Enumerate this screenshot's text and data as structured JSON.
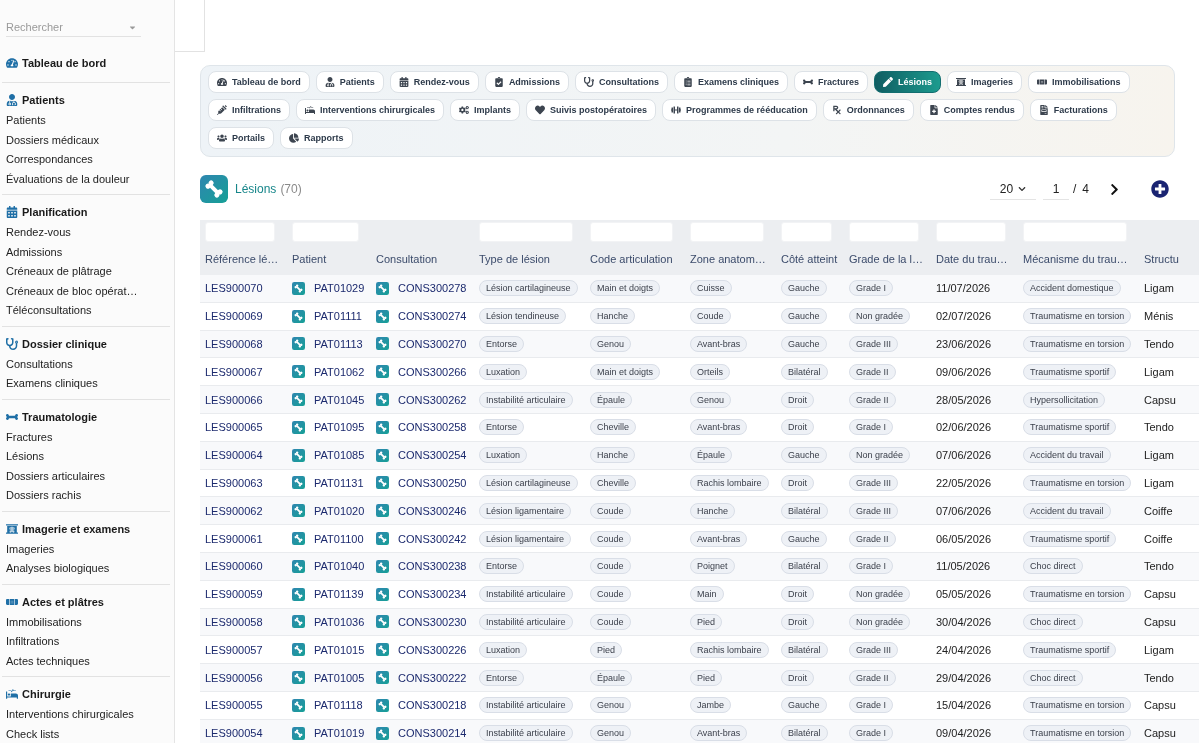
{
  "sidebar": {
    "search": {
      "placeholder": "Rechercher"
    },
    "sections": [
      {
        "title": "Tableau de bord"
      },
      {
        "title": "Patients",
        "items": [
          "Patients",
          "Dossiers médicaux",
          "Correspondances",
          "Évaluations de la douleur"
        ]
      },
      {
        "title": "Planification",
        "items": [
          "Rendez-vous",
          "Admissions",
          "Créneaux de plâtrage",
          "Créneaux de bloc opérat…",
          "Téléconsultations"
        ]
      },
      {
        "title": "Dossier clinique",
        "items": [
          "Consultations",
          "Examens cliniques"
        ]
      },
      {
        "title": "Traumatologie",
        "items": [
          "Fractures",
          "Lésions",
          "Dossiers articulaires",
          "Dossiers rachis"
        ]
      },
      {
        "title": "Imagerie et examens",
        "items": [
          "Imageries",
          "Analyses biologiques"
        ]
      },
      {
        "title": "Actes et plâtres",
        "items": [
          "Immobilisations",
          "Infiltrations",
          "Actes techniques"
        ]
      },
      {
        "title": "Chirurgie",
        "items": [
          "Interventions chirurgicales",
          "Check lists"
        ]
      }
    ]
  },
  "tabs": [
    {
      "label": "Tableau de bord",
      "selected": false
    },
    {
      "label": "Patients",
      "selected": false
    },
    {
      "label": "Rendez-vous",
      "selected": false
    },
    {
      "label": "Admissions",
      "selected": false
    },
    {
      "label": "Consultations",
      "selected": false
    },
    {
      "label": "Examens cliniques",
      "selected": false
    },
    {
      "label": "Fractures",
      "selected": false
    },
    {
      "label": "Lésions",
      "selected": true
    },
    {
      "label": "Imageries",
      "selected": false
    },
    {
      "label": "Immobilisations",
      "selected": false
    },
    {
      "label": "Infiltrations",
      "selected": false
    },
    {
      "label": "Interventions chirurgicales",
      "selected": false
    },
    {
      "label": "Implants",
      "selected": false
    },
    {
      "label": "Suivis postopératoires",
      "selected": false
    },
    {
      "label": "Programmes de rééducation",
      "selected": false
    },
    {
      "label": "Ordonnances",
      "selected": false
    },
    {
      "label": "Comptes rendus",
      "selected": false
    },
    {
      "label": "Facturations",
      "selected": false
    },
    {
      "label": "Portails",
      "selected": false
    },
    {
      "label": "Rapports",
      "selected": false
    }
  ],
  "header": {
    "title": "Lésions",
    "count": "(70)"
  },
  "pagination": {
    "page_size": "20",
    "page": "1",
    "separator": "/",
    "page_count": "4"
  },
  "table": {
    "columns": [
      {
        "label": "Référence lé…",
        "kind": "link",
        "filter": true
      },
      {
        "label": "Patient",
        "kind": "record",
        "filter": true
      },
      {
        "label": "Consultation",
        "kind": "record",
        "filter": false
      },
      {
        "label": "Type de lésion",
        "kind": "tag",
        "filter": true
      },
      {
        "label": "Code articulation",
        "kind": "tag",
        "filter": true
      },
      {
        "label": "Zone anatom…",
        "kind": "tag",
        "filter": true
      },
      {
        "label": "Côté atteint",
        "kind": "tag",
        "filter": true
      },
      {
        "label": "Grade de la l…",
        "kind": "tag",
        "filter": true
      },
      {
        "label": "Date du trau…",
        "kind": "text",
        "filter": true
      },
      {
        "label": "Mécanisme du trau…",
        "kind": "tag",
        "filter": true
      },
      {
        "label": "Structu",
        "kind": "text",
        "filter": false
      }
    ],
    "rows": [
      [
        "LES900070",
        "PAT01029",
        "CONS300278",
        "Lésion cartilagineuse",
        "Main et doigts",
        "Cuisse",
        "Gauche",
        "Grade I",
        "11/07/2026",
        "Accident domestique",
        "Ligam"
      ],
      [
        "LES900069",
        "PAT01111",
        "CONS300274",
        "Lésion tendineuse",
        "Hanche",
        "Coude",
        "Gauche",
        "Non gradée",
        "02/07/2026",
        "Traumatisme en torsion",
        "Ménis"
      ],
      [
        "LES900068",
        "PAT01113",
        "CONS300270",
        "Entorse",
        "Genou",
        "Avant-bras",
        "Gauche",
        "Grade III",
        "23/06/2026",
        "Traumatisme en torsion",
        "Tendo"
      ],
      [
        "LES900067",
        "PAT01062",
        "CONS300266",
        "Luxation",
        "Main et doigts",
        "Orteils",
        "Bilatéral",
        "Grade II",
        "09/06/2026",
        "Traumatisme sportif",
        "Ligam"
      ],
      [
        "LES900066",
        "PAT01045",
        "CONS300262",
        "Instabilité articulaire",
        "Épaule",
        "Genou",
        "Droit",
        "Grade II",
        "28/05/2026",
        "Hypersollicitation",
        "Capsu"
      ],
      [
        "LES900065",
        "PAT01095",
        "CONS300258",
        "Entorse",
        "Cheville",
        "Avant-bras",
        "Droit",
        "Grade I",
        "02/06/2026",
        "Traumatisme sportif",
        "Tendo"
      ],
      [
        "LES900064",
        "PAT01085",
        "CONS300254",
        "Luxation",
        "Hanche",
        "Épaule",
        "Gauche",
        "Non gradée",
        "07/06/2026",
        "Accident du travail",
        "Ligam"
      ],
      [
        "LES900063",
        "PAT01131",
        "CONS300250",
        "Lésion cartilagineuse",
        "Cheville",
        "Rachis lombaire",
        "Droit",
        "Grade III",
        "22/05/2026",
        "Traumatisme en torsion",
        "Ligam"
      ],
      [
        "LES900062",
        "PAT01020",
        "CONS300246",
        "Lésion ligamentaire",
        "Coude",
        "Hanche",
        "Bilatéral",
        "Grade III",
        "07/06/2026",
        "Accident du travail",
        "Coiffe"
      ],
      [
        "LES900061",
        "PAT01100",
        "CONS300242",
        "Lésion ligamentaire",
        "Coude",
        "Avant-bras",
        "Gauche",
        "Grade II",
        "06/05/2026",
        "Traumatisme sportif",
        "Coiffe"
      ],
      [
        "LES900060",
        "PAT01040",
        "CONS300238",
        "Entorse",
        "Coude",
        "Poignet",
        "Bilatéral",
        "Grade I",
        "11/05/2026",
        "Choc direct",
        "Tendo"
      ],
      [
        "LES900059",
        "PAT01139",
        "CONS300234",
        "Instabilité articulaire",
        "Coude",
        "Main",
        "Droit",
        "Non gradée",
        "05/05/2026",
        "Traumatisme en torsion",
        "Capsu"
      ],
      [
        "LES900058",
        "PAT01036",
        "CONS300230",
        "Instabilité articulaire",
        "Coude",
        "Pied",
        "Droit",
        "Non gradée",
        "30/04/2026",
        "Choc direct",
        "Capsu"
      ],
      [
        "LES900057",
        "PAT01015",
        "CONS300226",
        "Luxation",
        "Pied",
        "Rachis lombaire",
        "Bilatéral",
        "Grade III",
        "24/04/2026",
        "Traumatisme sportif",
        "Ligam"
      ],
      [
        "LES900056",
        "PAT01005",
        "CONS300222",
        "Entorse",
        "Épaule",
        "Pied",
        "Droit",
        "Grade II",
        "29/04/2026",
        "Choc direct",
        "Tendo"
      ],
      [
        "LES900055",
        "PAT01118",
        "CONS300218",
        "Instabilité articulaire",
        "Genou",
        "Jambe",
        "Gauche",
        "Grade I",
        "15/04/2026",
        "Traumatisme en torsion",
        "Capsu"
      ],
      [
        "LES900054",
        "PAT01019",
        "CONS300214",
        "Instabilité articulaire",
        "Genou",
        "Avant-bras",
        "Bilatéral",
        "Grade I",
        "09/04/2026",
        "Traumatisme en torsion",
        "Capsu"
      ]
    ]
  }
}
